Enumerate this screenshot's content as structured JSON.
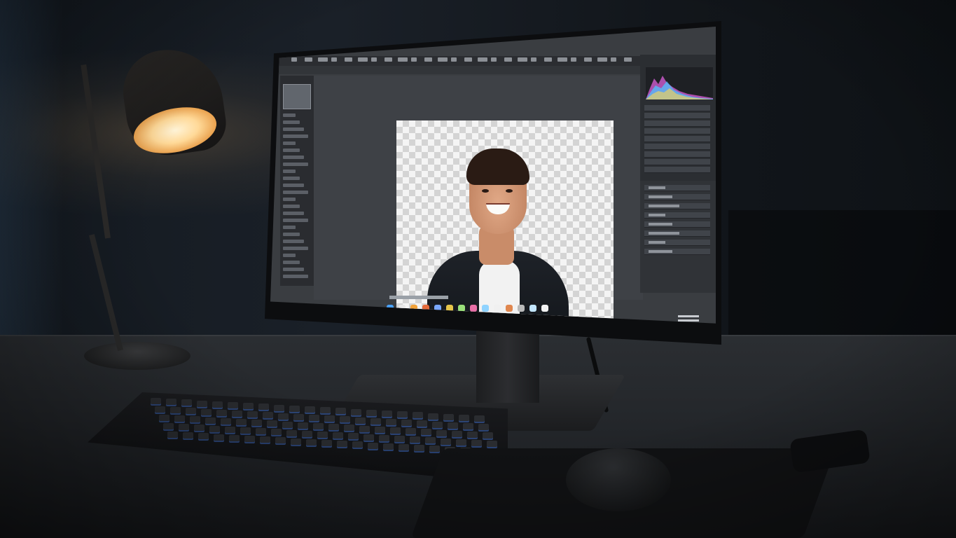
{
  "scene": {
    "subject": "",
    "lamp_glow_color": "#ffd998",
    "keyboard_backlight_color": "#4a86ff"
  },
  "editor": {
    "taskbar_icon_colors": [
      "#4aa3ff",
      "#e8e8e8",
      "#f2a23a",
      "#e66b3b",
      "#7aa7ff",
      "#e6c54a",
      "#9adf7a",
      "#e86fa6",
      "#8fd3ff",
      "#f0f0f0",
      "#e0874f",
      "#b9b9b9",
      "#c3e6ff",
      "#f2f2f2"
    ],
    "canvas_background": "transparent-checkerboard"
  }
}
